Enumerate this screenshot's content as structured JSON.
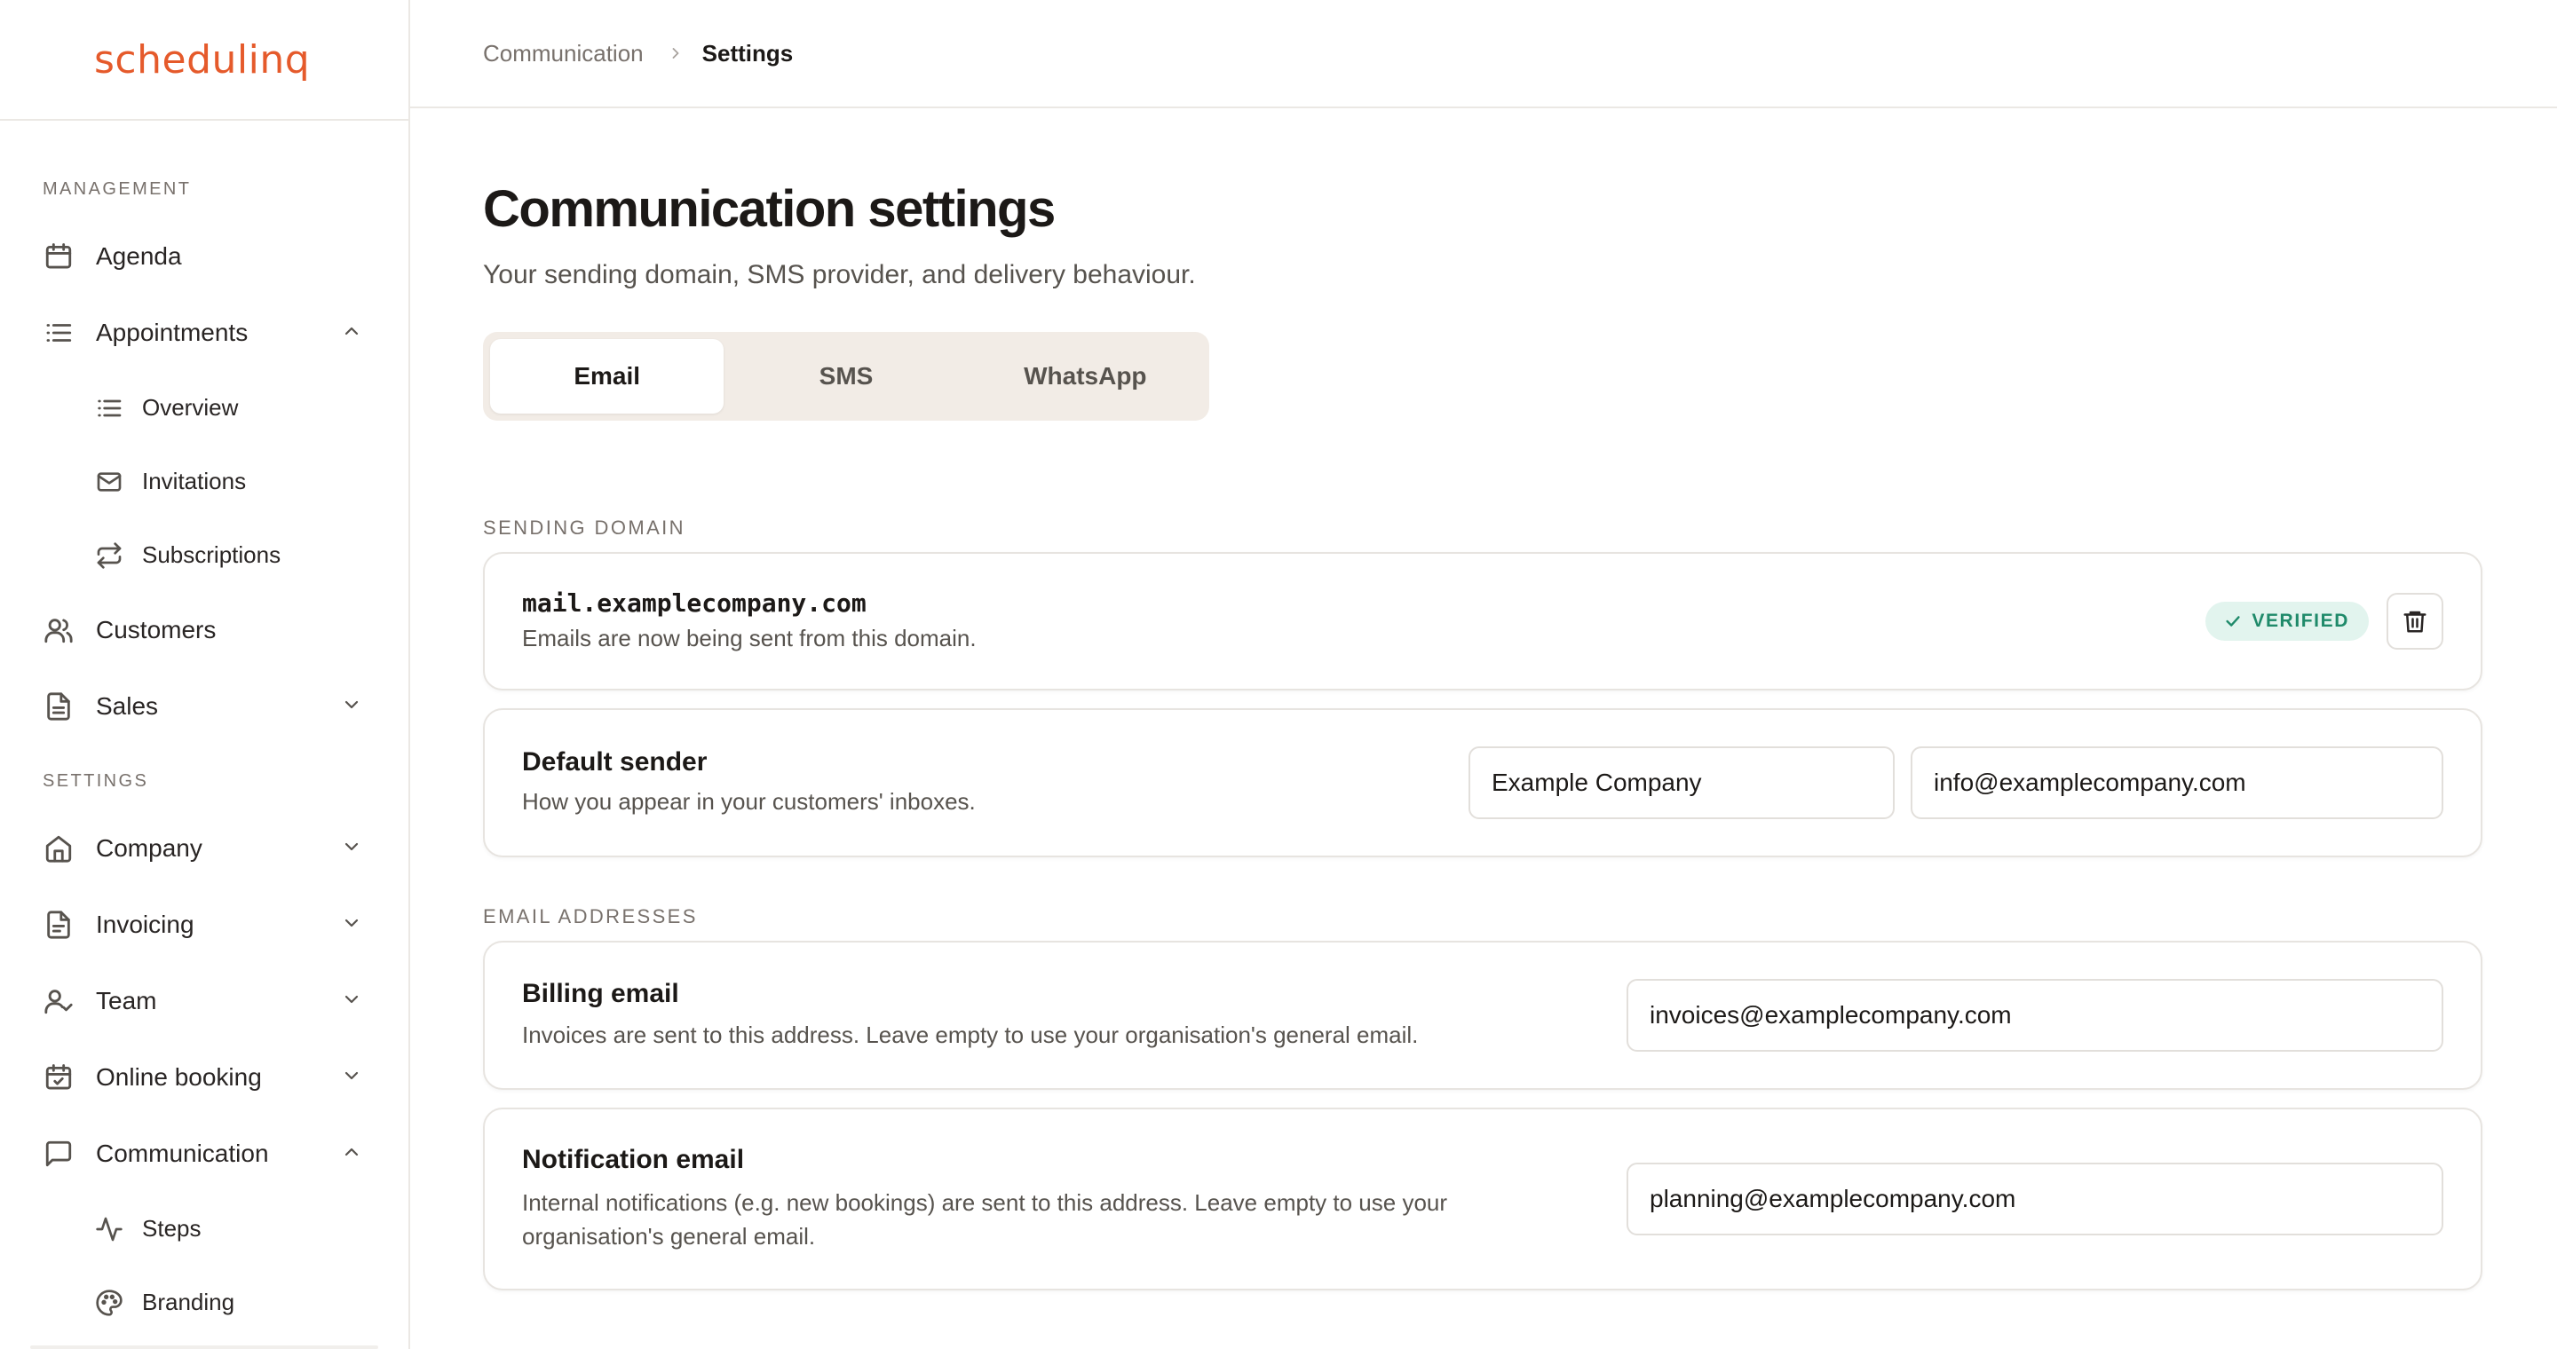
{
  "app": {
    "logo": "schedulinq"
  },
  "sidebar": {
    "sections": {
      "management": "MANAGEMENT",
      "settings": "SETTINGS"
    },
    "items": {
      "agenda": "Agenda",
      "appointments": "Appointments",
      "overview": "Overview",
      "invitations": "Invitations",
      "subscriptions": "Subscriptions",
      "customers": "Customers",
      "sales": "Sales",
      "company": "Company",
      "invoicing": "Invoicing",
      "team": "Team",
      "online_booking": "Online booking",
      "communication": "Communication",
      "steps": "Steps",
      "branding": "Branding"
    }
  },
  "breadcrumb": {
    "parent": "Communication",
    "current": "Settings"
  },
  "page": {
    "title": "Communication settings",
    "subtitle": "Your sending domain, SMS provider, and delivery behaviour."
  },
  "tabs": {
    "email": "Email",
    "sms": "SMS",
    "whatsapp": "WhatsApp",
    "active": "Email"
  },
  "sending_domain": {
    "section_label": "SENDING DOMAIN",
    "domain": "mail.examplecompany.com",
    "description": "Emails are now being sent from this domain.",
    "status": "VERIFIED"
  },
  "default_sender": {
    "title": "Default sender",
    "description": "How you appear in your customers' inboxes.",
    "name_value": "Example Company",
    "email_value": "info@examplecompany.com"
  },
  "email_addresses": {
    "section_label": "EMAIL ADDRESSES",
    "billing": {
      "title": "Billing email",
      "description": "Invoices are sent to this address. Leave empty to use your organisation's general email.",
      "value": "invoices@examplecompany.com"
    },
    "notification": {
      "title": "Notification email",
      "description": "Internal notifications (e.g. new bookings) are sent to this address. Leave empty to use your organisation's general email.",
      "value": "planning@examplecompany.com"
    }
  },
  "colors": {
    "brand": "#e55a2b",
    "verified": "#1f8a6a",
    "tab_bg": "#f2ece6"
  }
}
